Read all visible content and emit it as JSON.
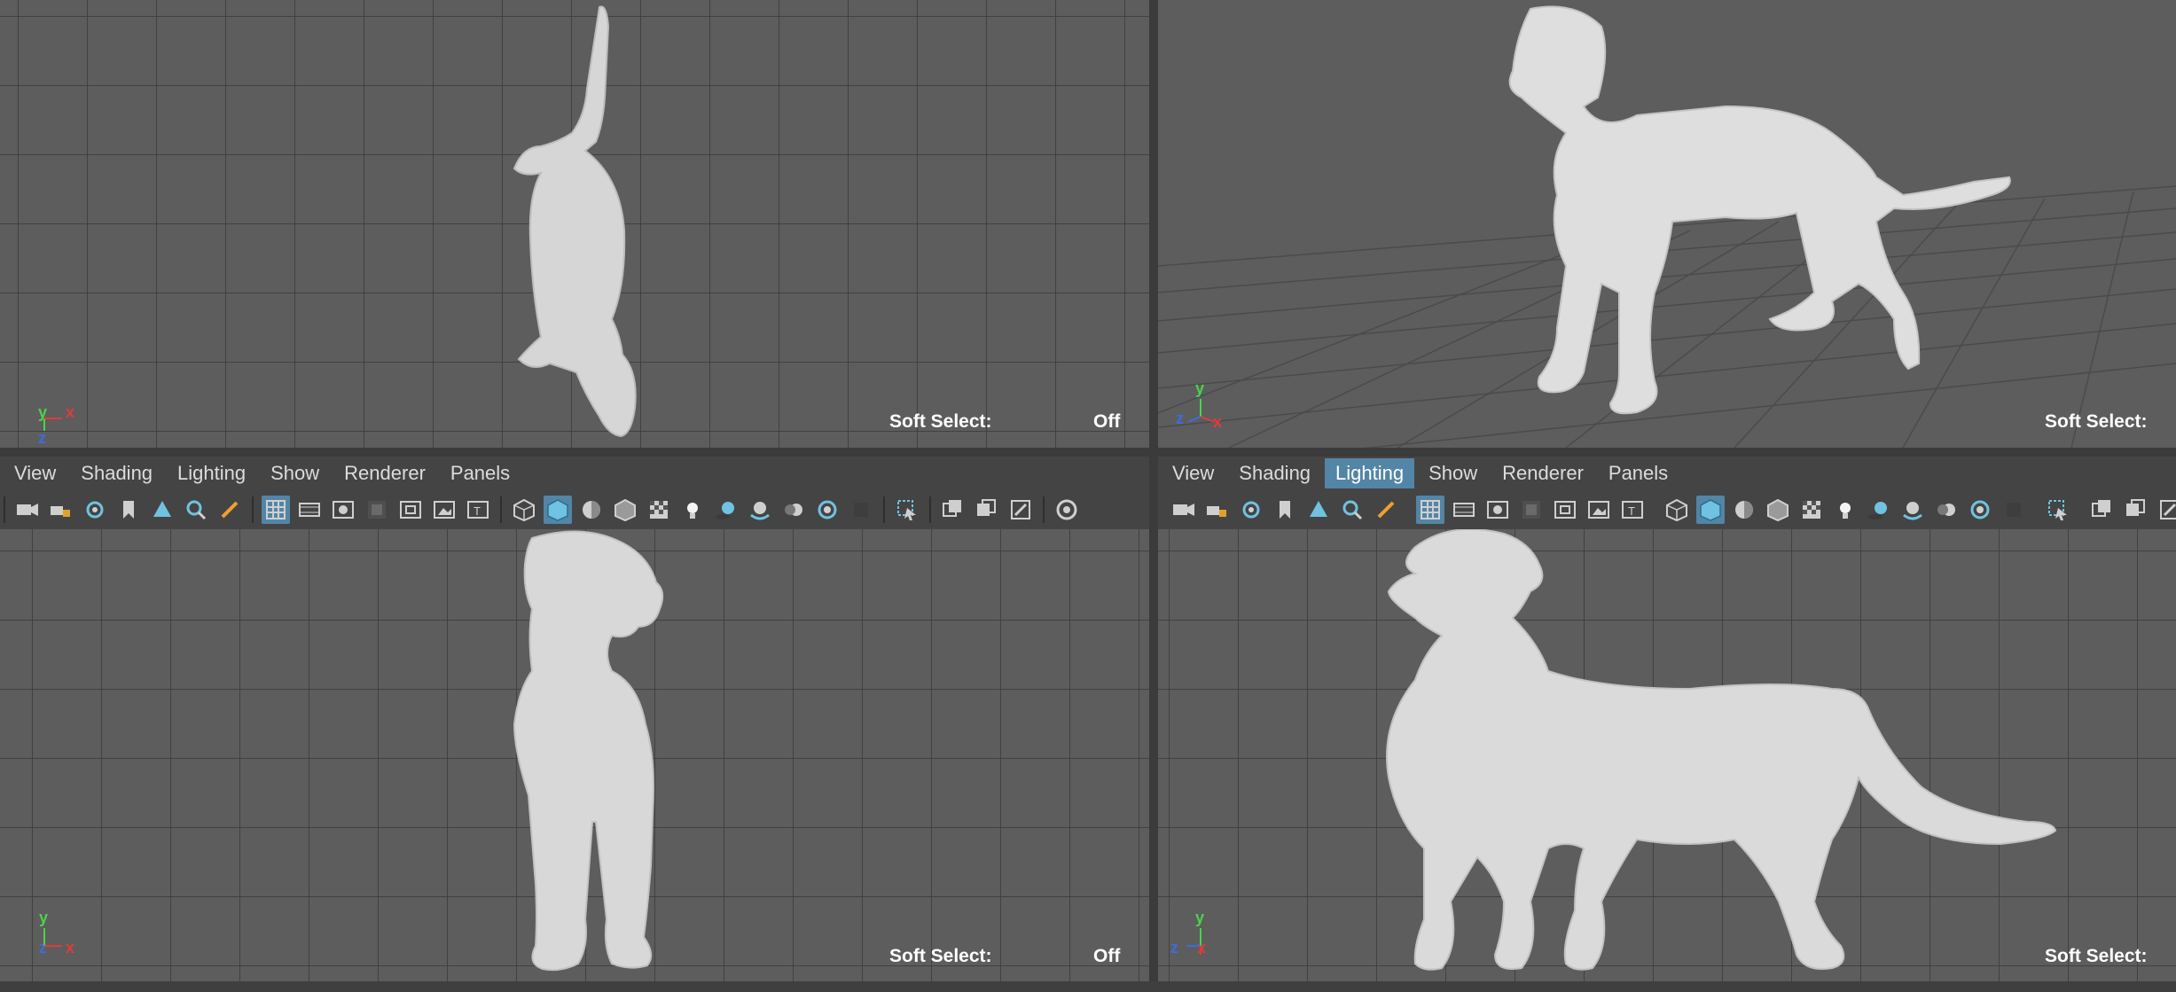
{
  "colors": {
    "viewport_bg": "#5d5d5d",
    "toolbar_bg": "#444444",
    "highlight": "#5285a6",
    "axis_x": "#e03b3b",
    "axis_y": "#4cd24c",
    "axis_z": "#3d6ce0",
    "model": "#dcdcdc"
  },
  "views": {
    "top": {
      "soft_select_label": "Soft Select:",
      "soft_select_value": "Off",
      "axis_y": "y",
      "axis_x": "x",
      "axis_z": "z"
    },
    "persp": {
      "soft_select_label": "Soft Select:",
      "axis_y": "y",
      "axis_x": "x",
      "axis_z": "z"
    },
    "front": {
      "soft_select_label": "Soft Select:",
      "soft_select_value": "Off",
      "axis_y": "y",
      "axis_x": "x",
      "axis_z": "z"
    },
    "side": {
      "soft_select_label": "Soft Select:",
      "axis_y": "y",
      "axis_x": "x",
      "axis_z": "z"
    }
  },
  "menu_left": [
    "View",
    "Shading",
    "Lighting",
    "Show",
    "Renderer",
    "Panels"
  ],
  "menu_right": [
    "View",
    "Shading",
    "Lighting",
    "Show",
    "Renderer",
    "Panels"
  ],
  "menu_right_active": "Lighting",
  "toolbar_icons": [
    "camera-icon",
    "lock-camera-icon",
    "camera-attributes-icon",
    "bookmark-icon",
    "image-plane-icon",
    "2d-pan-zoom-icon",
    "grease-pencil-icon",
    "grid-icon",
    "film-gate-icon",
    "resolution-gate-icon",
    "gate-mask-icon",
    "field-chart-icon",
    "safe-action-icon",
    "safe-title-icon",
    "wireframe-icon",
    "smooth-shade-icon",
    "default-material-icon",
    "wireframe-on-shaded-icon",
    "textured-icon",
    "lights-icon",
    "shadows-icon",
    "screen-space-ao-icon",
    "motion-blur-icon",
    "anti-aliasing-icon",
    "depth-of-field-icon",
    "isolate-select-icon",
    "xray-icon",
    "xray-active-icon",
    "xray-joints-icon",
    "ui-toggle-icon"
  ]
}
